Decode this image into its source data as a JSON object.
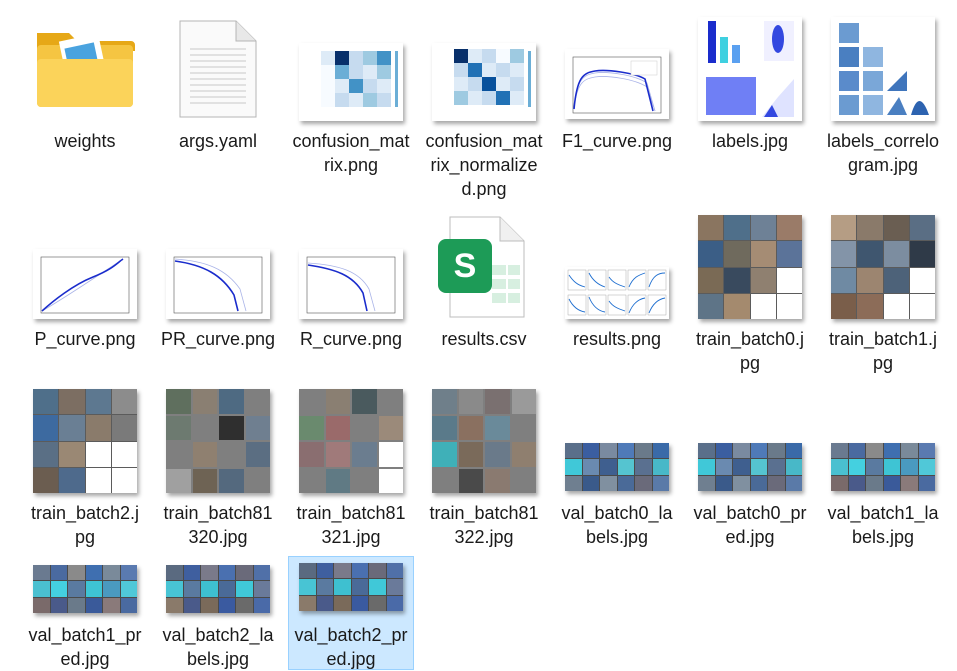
{
  "files": [
    {
      "label": "weights",
      "kind": "folder"
    },
    {
      "label": "args.yaml",
      "kind": "document"
    },
    {
      "label": "confusion_matrix.png",
      "kind": "heatmap"
    },
    {
      "label": "confusion_matrix_normalized.png",
      "kind": "heatmap"
    },
    {
      "label": "F1_curve.png",
      "kind": "curve"
    },
    {
      "label": "labels.jpg",
      "kind": "labels"
    },
    {
      "label": "labels_correlogram.jpg",
      "kind": "correlogram"
    },
    {
      "label": "P_curve.png",
      "kind": "curve"
    },
    {
      "label": "PR_curve.png",
      "kind": "curve"
    },
    {
      "label": "R_curve.png",
      "kind": "curve"
    },
    {
      "label": "results.csv",
      "kind": "spreadsheet"
    },
    {
      "label": "results.png",
      "kind": "results"
    },
    {
      "label": "train_batch0.jpg",
      "kind": "mosaic"
    },
    {
      "label": "train_batch1.jpg",
      "kind": "mosaic"
    },
    {
      "label": "train_batch2.jpg",
      "kind": "mosaic"
    },
    {
      "label": "train_batch81320.jpg",
      "kind": "mosaic-gray"
    },
    {
      "label": "train_batch81321.jpg",
      "kind": "mosaic-gray"
    },
    {
      "label": "train_batch81322.jpg",
      "kind": "mosaic-gray"
    },
    {
      "label": "val_batch0_labels.jpg",
      "kind": "strip"
    },
    {
      "label": "val_batch0_pred.jpg",
      "kind": "strip"
    },
    {
      "label": "val_batch1_labels.jpg",
      "kind": "strip"
    },
    {
      "label": "val_batch1_pred.jpg",
      "kind": "strip"
    },
    {
      "label": "val_batch2_labels.jpg",
      "kind": "strip"
    },
    {
      "label": "val_batch2_pred.jpg",
      "kind": "strip"
    }
  ],
  "selected_label": "val_batch2_pred.jpg",
  "colors": {
    "folder": "#f5c542",
    "selection_bg": "#cce8ff",
    "selection_border": "#99d1ff",
    "excel_green": "#1d9b57"
  }
}
